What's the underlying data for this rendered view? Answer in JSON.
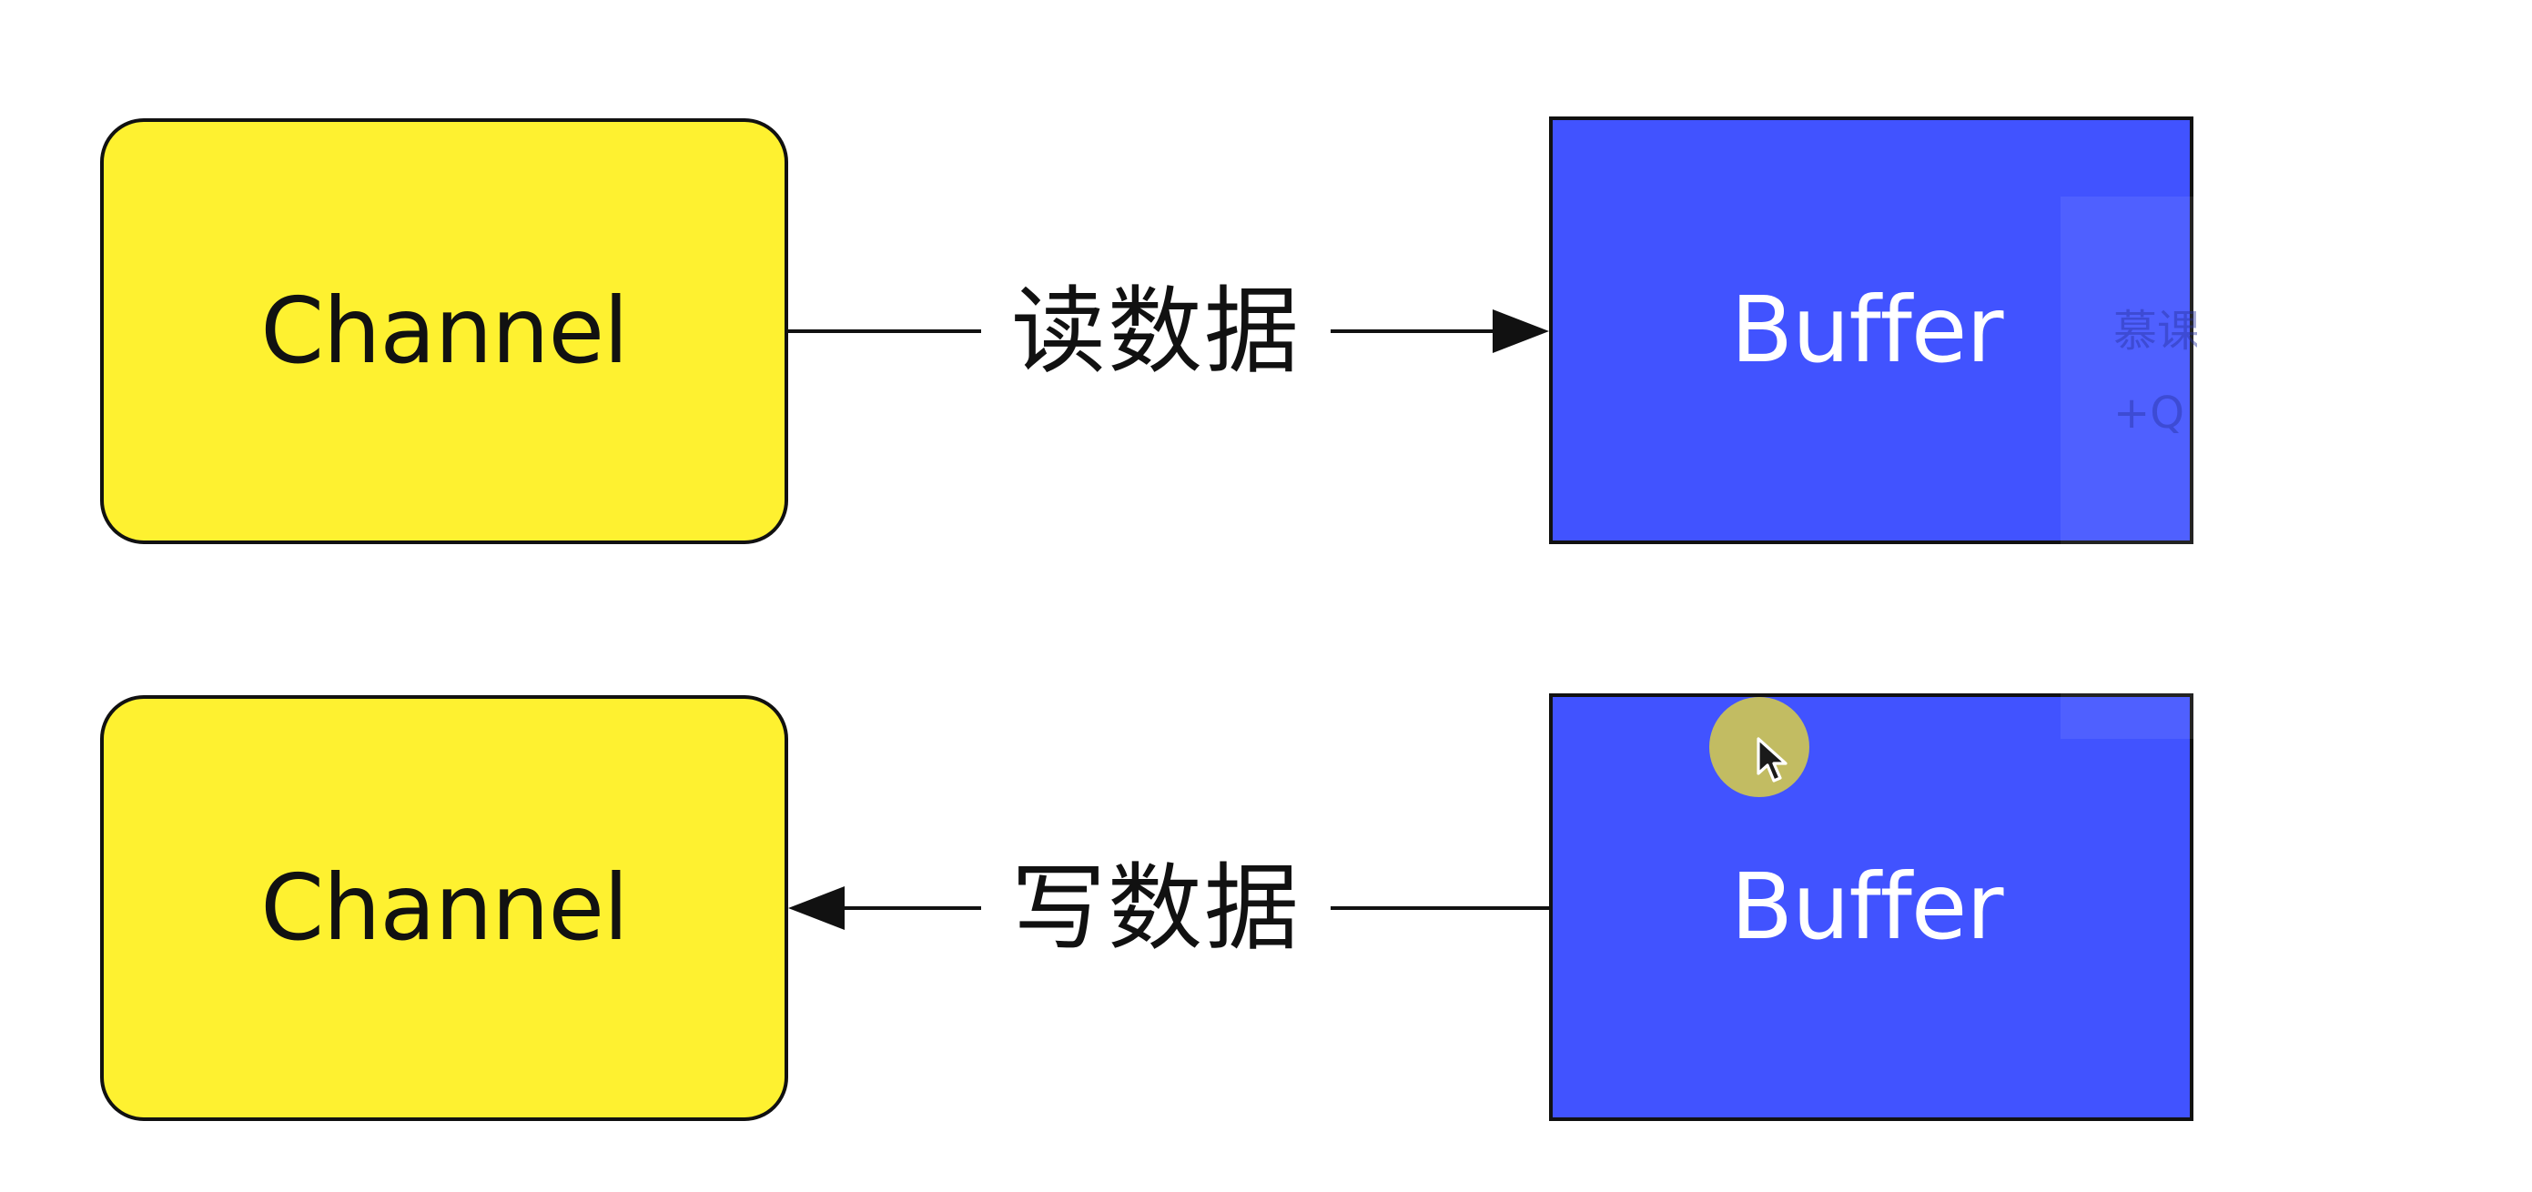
{
  "diagram": {
    "nodes": [
      {
        "id": "channel-top",
        "label": "Channel",
        "kind": "channel"
      },
      {
        "id": "buffer-top",
        "label": "Buffer",
        "kind": "buffer"
      },
      {
        "id": "channel-bottom",
        "label": "Channel",
        "kind": "channel"
      },
      {
        "id": "buffer-bottom",
        "label": "Buffer",
        "kind": "buffer"
      }
    ],
    "edges": [
      {
        "from": "channel-top",
        "to": "buffer-top",
        "label": "读数据"
      },
      {
        "from": "buffer-bottom",
        "to": "channel-bottom",
        "label": "写数据"
      }
    ]
  },
  "overlay": {
    "ghost_line_1": "慕课",
    "ghost_line_2": "+Q"
  },
  "colors": {
    "channel_fill": "#fef130",
    "buffer_fill": "#4153ff",
    "stroke": "#111111",
    "cursor_halo": "#c9c25a"
  },
  "icons": {
    "cursor": "mouse-pointer-icon"
  }
}
